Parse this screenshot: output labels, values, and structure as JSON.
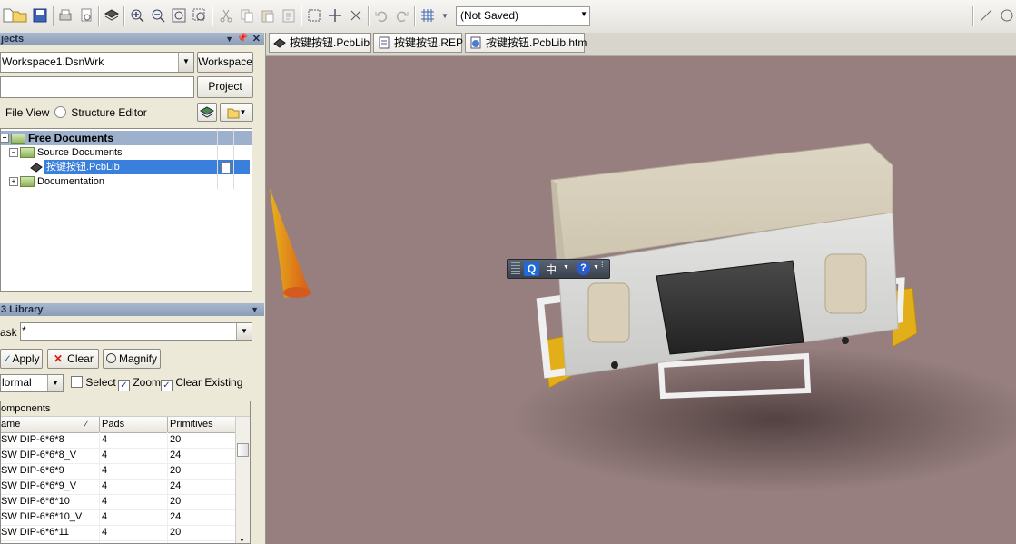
{
  "toolbar": {
    "icons": [
      "new-icon",
      "open-icon",
      "save-icon",
      "print-icon",
      "print-preview-icon",
      "3d-layer-icon",
      "zoom-in-icon",
      "zoom-out-icon",
      "zoom-fit-icon",
      "zoom-area-icon",
      "cut-icon",
      "copy-icon",
      "paste-icon",
      "paste-special-icon",
      "select-rect-icon",
      "move-icon",
      "cross-select-icon",
      "undo-icon",
      "redo-icon",
      "grid-icon"
    ],
    "not_saved": "(Not Saved)"
  },
  "projects_panel": {
    "title": "jects",
    "workspace_value": "Workspace1.DsnWrk",
    "workspace_button": "Workspace",
    "project_value": "",
    "project_button": "Project",
    "file_view_label": "File View",
    "structure_editor_label": "Structure Editor",
    "tree": {
      "free_documents": "Free Documents",
      "source_documents": "Source Documents",
      "pcblib_file": "按键按钮.PcbLib",
      "documentation": "Documentation"
    }
  },
  "library_panel": {
    "title": "3 Library",
    "mask_label": "ask",
    "mask_value": "*",
    "apply_button": "Apply",
    "clear_button": "Clear",
    "magnify_button": "Magnify",
    "mode_value": "lormal",
    "select_label": "Select",
    "zoom_label": "Zoom",
    "clear_existing_label": "Clear Existing",
    "select_checked": false,
    "zoom_checked": true,
    "clear_existing_checked": true,
    "components_header": "omponents",
    "columns": [
      "ame",
      "Pads",
      "Primitives"
    ],
    "rows": [
      {
        "name": "SW DIP-6*6*8",
        "pads": "4",
        "primitives": "20"
      },
      {
        "name": "SW DIP-6*6*8_V",
        "pads": "4",
        "primitives": "24"
      },
      {
        "name": "SW DIP-6*6*9",
        "pads": "4",
        "primitives": "20"
      },
      {
        "name": "SW DIP-6*6*9_V",
        "pads": "4",
        "primitives": "24"
      },
      {
        "name": "SW DIP-6*6*10",
        "pads": "4",
        "primitives": "20"
      },
      {
        "name": "SW DIP-6*6*10_V",
        "pads": "4",
        "primitives": "24"
      },
      {
        "name": "SW DIP-6*6*11",
        "pads": "4",
        "primitives": "20"
      }
    ]
  },
  "tabs": [
    {
      "label": "按键按钮.PcbLib",
      "icon": "pcblib-icon"
    },
    {
      "label": "按键按钮.REP",
      "icon": "report-icon"
    },
    {
      "label": "按键按钮.PcbLib.htm",
      "icon": "html-icon"
    }
  ],
  "ime_bar": {
    "q_label": "Q",
    "lang_label": "中"
  },
  "colors": {
    "viewport_bg": "#967f7e",
    "panel_head": "#98aac4",
    "selection": "#3b7fdc"
  }
}
